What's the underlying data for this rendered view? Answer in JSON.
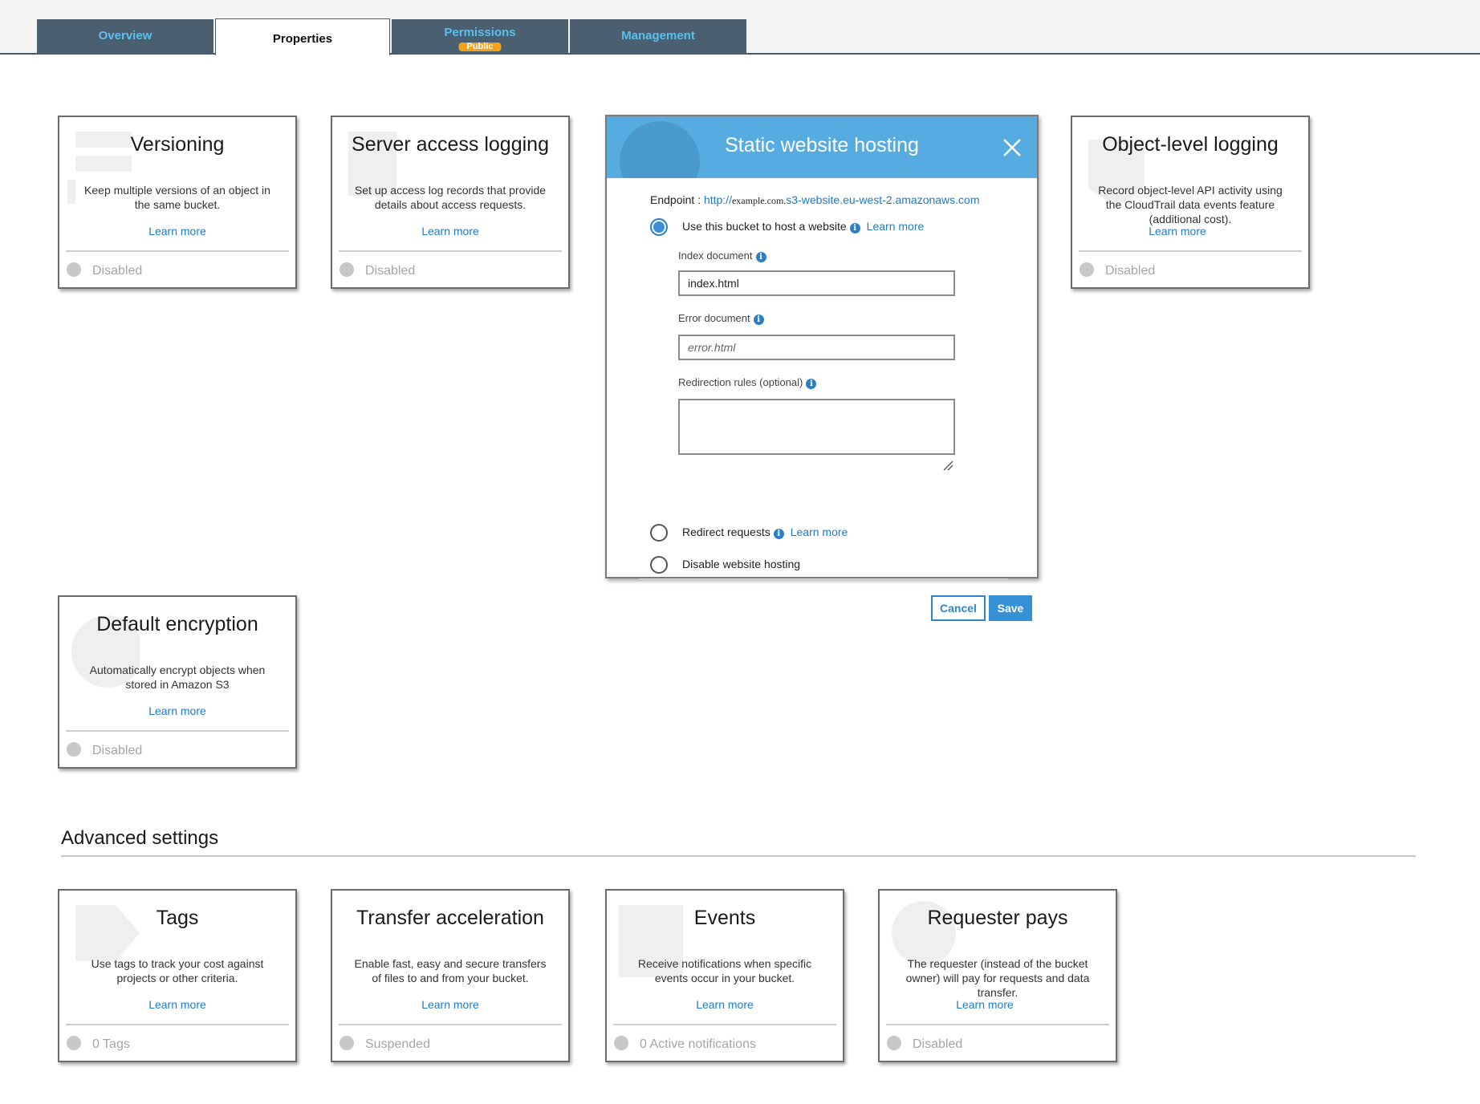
{
  "tabs": [
    {
      "label": "Overview",
      "active": false
    },
    {
      "label": "Properties",
      "active": true
    },
    {
      "label": "Permissions",
      "badge": "Public",
      "active": false
    },
    {
      "label": "Management",
      "active": false
    }
  ],
  "cards_top": [
    {
      "title": "Versioning",
      "description": "Keep multiple versions of an object in the same bucket.",
      "link": "Learn more",
      "status": "Disabled"
    },
    {
      "title": "Server access logging",
      "description": "Set up access log records that provide details about access requests.",
      "link": "Learn more",
      "status": "Disabled"
    },
    {
      "title": "Object-level logging",
      "description": "Record object-level API activity using the CloudTrail data events feature (additional cost).",
      "link": "Learn more",
      "status": "Disabled"
    },
    {
      "title": "Default encryption",
      "description": "Automatically encrypt objects when stored in Amazon S3",
      "link": "Learn more",
      "status": "Disabled"
    }
  ],
  "modal": {
    "title": "Static website hosting",
    "endpoint_label": "Endpoint :",
    "endpoint_prefix": "http://",
    "endpoint_example": "example.com.",
    "endpoint_suffix": "s3-website.eu-west-2.amazonaws.com",
    "option_host": "Use this bucket to host a website",
    "option_host_link": "Learn more",
    "index_label": "Index document",
    "index_value": "index.html",
    "error_label": "Error document",
    "error_placeholder": "error.html",
    "redirection_label": "Redirection rules (optional)",
    "option_redirect": "Redirect requests",
    "option_redirect_link": "Learn more",
    "option_disable": "Disable website hosting",
    "cancel_label": "Cancel",
    "save_label": "Save"
  },
  "advanced": {
    "heading": "Advanced settings",
    "cards": [
      {
        "title": "Tags",
        "description": "Use tags to track your cost against projects or other criteria.",
        "link": "Learn more",
        "status": "0 Tags"
      },
      {
        "title": "Transfer acceleration",
        "description": "Enable fast, easy and secure transfers of files to and from your bucket.",
        "link": "Learn more",
        "status": "Suspended"
      },
      {
        "title": "Events",
        "description": "Receive notifications when specific events occur in your bucket.",
        "link": "Learn more",
        "status": "0 Active notifications"
      },
      {
        "title": "Requester pays",
        "description": "The requester (instead of the bucket owner) will pay for requests and data transfer.",
        "link": "Learn more",
        "status": "Disabled"
      }
    ]
  },
  "colors": {
    "tab_bg": "#4a5f6f",
    "tab_text": "#5bc0ef",
    "badge": "#f2a01e",
    "modal_header": "#56ace0",
    "link": "#1f7bc1",
    "primary_button": "#3590d6"
  },
  "icons": {
    "close": "close-icon",
    "info": "info-icon",
    "status_dot": "status-dot-icon",
    "resize": "resize-grip-icon"
  }
}
